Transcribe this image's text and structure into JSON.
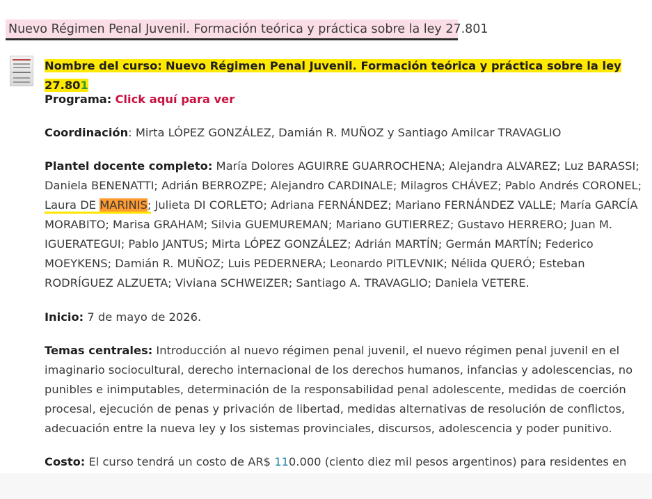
{
  "page_title": "Nuevo Régimen Penal Juvenil. Formación teórica y práctica sobre la ley 27.801",
  "course": {
    "name_label": "Nombre del curso:",
    "name_value": "Nuevo Régimen Penal Juvenil. Formación teórica y práctica sobre la ley 27.80",
    "name_tail": "1"
  },
  "program": {
    "label": "Programa:",
    "link": "Click aquí para ver"
  },
  "coordination": {
    "label": "Coordinación",
    "value": ": Mirta LÓPEZ GONZÁLEZ, Damián R. MUÑOZ y Santiago Amilcar TRAVAGLIO"
  },
  "faculty": {
    "label": "Plantel docente completo:",
    "text_1": " María Dolores AGUIRRE GUARROCHENA; Alejandra ALVAREZ; Luz BARASSI; Daniela BENENATTI; Adrián BERROZPE; Alejandro CARDINALE; Milagros CHÁVEZ; Pablo Andrés CORONEL; ",
    "highlight_first": "Laura DE ",
    "highlight_last": "MARINIS",
    "highlight_sep": ";",
    "text_2": " Julieta DI CORLETO; Adriana FERNÁNDEZ; Mariano FERNÁNDEZ VALLE; María GARCÍA MORABITO; Marisa GRAHAM; Silvia GUEMUREMAN; Mariano GUTIERREZ; Gustavo HERRERO; Juan M. IGUERATEGUI; Pablo JANTUS; Mirta LÓPEZ GONZÁLEZ; Adrián MARTÍN; Germán MARTÍN; Federico MOEYKENS; Damián R. MUÑOZ; Luis PEDERNERA; Leonardo PITLEVNIK; Nélida QUERÓ; Esteban RODRÍGUEZ ALZUETA; Viviana SCHWEIZER; Santiago A. TRAVAGLIO; Daniela VETERE."
  },
  "start": {
    "label": "Inicio:",
    "value": " 7 de mayo de 2026."
  },
  "topics": {
    "label": "Temas centrales:",
    "value": " Introducción al nuevo régimen penal juvenil, el nuevo régimen penal juvenil en el imaginario sociocultural, derecho internacional de los derechos humanos, infancias y adolescencias, no punibles e inimputables, determinación de la responsabilidad penal adolescente, medidas de coerción procesal, ejecución de penas y privación de libertad, medidas alternativas de resolución de conflictos, adecuación entre la nueva ley y los sistemas provinciales, discursos, adolescencia y poder punitivo."
  },
  "cost": {
    "label": "Costo:",
    "value_prefix": " El curso tendrá un costo de AR$ ",
    "amount_highlight": "11",
    "value_suffix": "0.000 (ciento diez mil pesos argentinos) para residentes en"
  },
  "colors": {
    "accent_link": "#c8103d",
    "highlight": "#ffe900",
    "highlight_orange": "#ff9b30",
    "title_bg": "#fbdde6"
  }
}
